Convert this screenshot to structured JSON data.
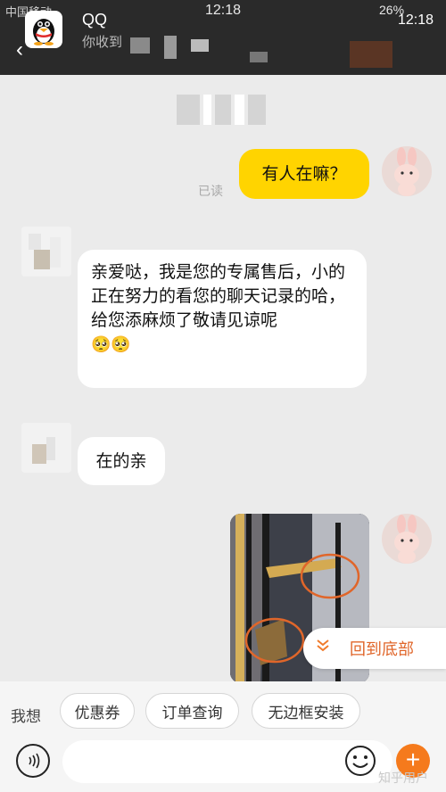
{
  "status_bar": {
    "carrier": "中国移动",
    "time_center": "12:18",
    "battery": "26%",
    "time_right": "12:18"
  },
  "notification": {
    "app_name": "QQ",
    "preview": "你收到"
  },
  "messages": {
    "me_text": "有人在嘛？",
    "read_label": "已读",
    "them1_text": "亲爱哒，我是您的专属售后，小的正在努力的看您的聊天记录的哈，给您添麻烦了敬请见谅呢",
    "them1_emoji": "🥺🥺",
    "them2_text": "在的亲"
  },
  "back_to_bottom": {
    "icon": "double-chevron-down-icon",
    "label": "回到底部"
  },
  "quick_phrases": {
    "label": "我想",
    "chips": [
      "优惠券",
      "订单查询",
      "无边框安装"
    ]
  },
  "input": {
    "placeholder": "",
    "voice_icon": "voice-icon",
    "emoji_icon": "smiley-icon",
    "plus_icon": "plus-icon"
  },
  "watermark": "知乎用户",
  "colors": {
    "accent_yellow": "#ffd400",
    "accent_orange": "#f57a1c",
    "link_orange": "#e0662a"
  }
}
